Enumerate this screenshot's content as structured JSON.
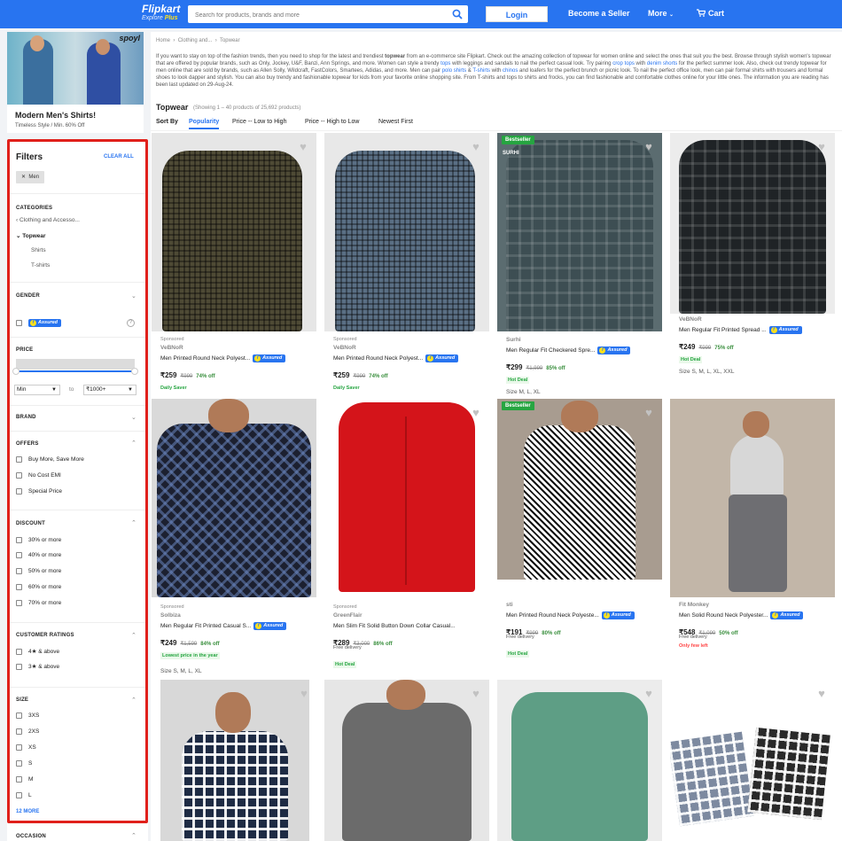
{
  "header": {
    "logo": "Flipkart",
    "logo_sub_prefix": "Explore ",
    "logo_sub_plus": "Plus",
    "search_placeholder": "Search for products, brands and more",
    "login": "Login",
    "become_seller": "Become a Seller",
    "more": "More",
    "cart": "Cart",
    "colors": {
      "bar": "#2874f0",
      "plus": "#ffe11b"
    }
  },
  "banner": {
    "brand": "spoyl",
    "title": "Modern Men's Shirts!",
    "subtitle": "Timeless Style / Min. 60% Off"
  },
  "filters": {
    "title": "Filters",
    "clear_all": "CLEAR ALL",
    "active_chip": "Men",
    "categories": {
      "title": "CATEGORIES",
      "parent": "Clothing and Accesso...",
      "current": "Topwear",
      "children": [
        "Shirts",
        "T-shirts"
      ]
    },
    "gender_title": "GENDER",
    "assured_label": "Assured",
    "price": {
      "title": "PRICE",
      "min": "Min",
      "to": "to",
      "max": "₹1000+"
    },
    "brand_title": "BRAND",
    "offers": {
      "title": "OFFERS",
      "items": [
        "Buy More, Save More",
        "No Cost EMI",
        "Special Price"
      ]
    },
    "discount": {
      "title": "DISCOUNT",
      "items": [
        "30% or more",
        "40% or more",
        "50% or more",
        "60% or more",
        "70% or more"
      ]
    },
    "ratings": {
      "title": "CUSTOMER RATINGS",
      "items": [
        "4★ & above",
        "3★ & above"
      ]
    },
    "size": {
      "title": "SIZE",
      "items": [
        "3XS",
        "2XS",
        "XS",
        "S",
        "M",
        "L"
      ],
      "more": "12 MORE"
    },
    "occasion_title": "OCCASION"
  },
  "main": {
    "breadcrumb": [
      "Home",
      "Clothing and...",
      "Topwear"
    ],
    "intro_parts": {
      "p1": "If you want to stay on top of the fashion trends, then you need to shop for the latest and trendiest ",
      "p1b": "topwear",
      "p2": " from an e-commerce site Flipkart. Check out the amazing collection of topwear for women online and select the ones that suit you the best. Browse through stylish women's topwear that are offered by popular brands, such as Only, Jockey, U&F, Banzi, Ann Springs, and more. Women can style a trendy ",
      "l1": "tops",
      "p3": " with leggings and sandals to nail the perfect casual look. Try pairing ",
      "l2": "crop tops",
      "p4": " with ",
      "l3": "denim shorts",
      "p5": " for the perfect summer look. Also, check out trendy topwear for men online that are sold by brands, such as Allen Solly, Wildcraft, FastColors, Smartees, Adidas, and more. Men can pair ",
      "l4": "polo shirts",
      "p6": " & ",
      "l5": "T-shirts",
      "p7": " with ",
      "l6": "chinos",
      "p8": " and loafers for the perfect brunch or picnic look. To nail the perfect office look, men can pair formal shirts with trousers and formal shoes to look dapper and stylish. You can also buy trendy and fashionable topwear for kids from your favorite online shopping site. From T-shirts and tops to shirts and frocks, you can find fashionable and comfortable clothes online for your little ones. The information you are reading has been last updated on 29-Aug-24."
    },
    "title": "Topwear",
    "showing": "(Showing 1 – 40 products of 25,692 products)",
    "sort": {
      "label": "Sort By",
      "options": [
        "Popularity",
        "Price -- Low to High",
        "Price -- High to Low",
        "Newest First"
      ],
      "active": "Popularity"
    }
  },
  "products": [
    {
      "sponsored": "Sponsored",
      "brand": "VeBNoR",
      "name": "Men Printed Round Neck Polyest...",
      "assured": true,
      "price": "₹259",
      "mrp": "₹999",
      "off": "74% off",
      "tag": "Daily Saver",
      "heart": "♥"
    },
    {
      "sponsored": "Sponsored",
      "brand": "VeBNoR",
      "name": "Men Printed Round Neck Polyest...",
      "assured": true,
      "price": "₹259",
      "mrp": "₹999",
      "off": "74% off",
      "tag": "Daily Saver",
      "heart": "♥"
    },
    {
      "badge": "Bestseller",
      "brand": "Surhi",
      "name": "Men Regular Fit Checkered Spre...",
      "assured": true,
      "price": "₹299",
      "mrp": "₹1,999",
      "off": "85% off",
      "tag": "Hot Deal",
      "sizes": "Size M, L, XL",
      "heart": "♥",
      "img_logo": "SURHI"
    },
    {
      "brand": "VeBNoR",
      "name": "Men Regular Fit Printed Spread ...",
      "assured": true,
      "price": "₹249",
      "mrp": "₹999",
      "off": "75% off",
      "tag": "Hot Deal",
      "sizes": "Size S, M, L, XL, XXL",
      "heart": "♥"
    },
    {
      "sponsored": "Sponsored",
      "brand": "Solbiza",
      "name": "Men Regular Fit Printed Casual S...",
      "assured": true,
      "price": "₹249",
      "mrp": "₹1,599",
      "off": "84% off",
      "tag": "Lowest price in the year",
      "sizes": "Size S, M, L, XL",
      "heart": "♥"
    },
    {
      "sponsored": "Sponsored",
      "brand": "GreenFlair",
      "name": "Men Slim Fit Solid Button Down Collar Casual...",
      "assured": false,
      "price": "₹289",
      "mrp": "₹3,000",
      "off": "86% off",
      "delivery": "Free delivery",
      "tag": "Hot Deal",
      "heart": "♥"
    },
    {
      "badge": "Bestseller",
      "brand": "sti",
      "name": "Men Printed Round Neck Polyeste...",
      "assured": true,
      "price": "₹191",
      "mrp": "₹999",
      "off": "80% off",
      "delivery": "Free delivery",
      "tag": "Hot Deal",
      "heart": "♥"
    },
    {
      "brand": "Fit Monkey",
      "name": "Men Solid Round Neck Polyester...",
      "assured": true,
      "price": "₹548",
      "mrp": "₹1,099",
      "off": "50% off",
      "delivery": "Free delivery",
      "tag_red": "Only few left",
      "heart": "♥"
    },
    {
      "heart": "♥"
    },
    {
      "heart": "♥"
    },
    {
      "heart": "♥"
    },
    {
      "heart": "♥"
    }
  ]
}
